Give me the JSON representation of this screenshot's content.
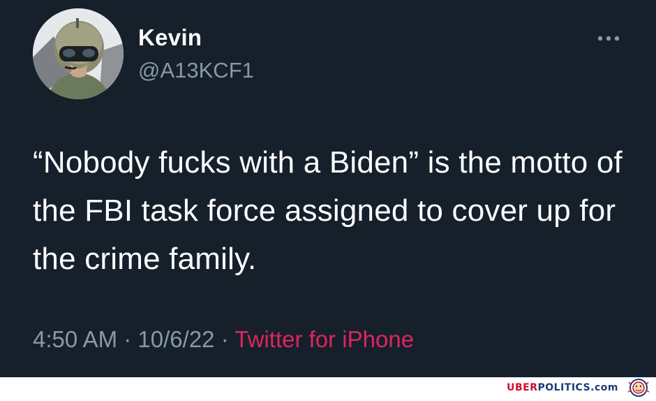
{
  "tweet": {
    "display_name": "Kevin",
    "handle": "@A13KCF1",
    "more_icon": "more-horizontal-icon",
    "text": "“Nobody fucks with a Biden” is the motto of the FBI task force assigned to cover up for the crime family.",
    "time": "4:50 AM",
    "separator": "·",
    "date": "10/6/22",
    "source": "Twitter for iPhone"
  },
  "watermark": {
    "part1": "UBER",
    "part2": "POLITICS.com",
    "logo_icon": "lion-seal-icon"
  },
  "colors": {
    "background": "#15202b",
    "primary_text": "#ffffff",
    "secondary_text": "#8899a6",
    "source_link": "#e0245e",
    "watermark_red": "#c8102e",
    "watermark_blue": "#1e3a78"
  }
}
